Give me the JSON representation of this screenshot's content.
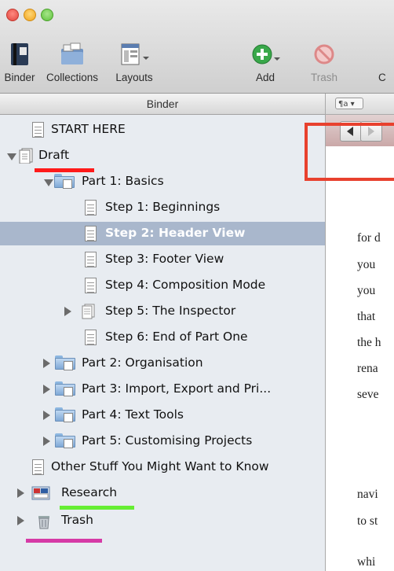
{
  "toolbar": {
    "items": [
      {
        "label": "Binder"
      },
      {
        "label": "Collections"
      },
      {
        "label": "Layouts"
      },
      {
        "label": "Add"
      },
      {
        "label": "Trash"
      },
      {
        "label": "C"
      }
    ]
  },
  "binder": {
    "title": "Binder",
    "rows": [
      {
        "label": "START HERE"
      },
      {
        "label": "Draft"
      },
      {
        "label": "Part 1: Basics"
      },
      {
        "label": "Step 1: Beginnings"
      },
      {
        "label": "Step 2: Header View"
      },
      {
        "label": "Step 3: Footer View"
      },
      {
        "label": "Step 4: Composition Mode"
      },
      {
        "label": "Step 5: The Inspector"
      },
      {
        "label": "Step 6: End of Part One"
      },
      {
        "label": "Part 2: Organisation"
      },
      {
        "label": "Part 3: Import, Export and Pri..."
      },
      {
        "label": "Part 4: Text Tools"
      },
      {
        "label": "Part 5: Customising Projects"
      },
      {
        "label": "Other Stuff You Might Want to Know"
      },
      {
        "label": "Research"
      },
      {
        "label": "Trash"
      }
    ]
  },
  "editor": {
    "format_button": "¶a ▾",
    "text_lines": [
      "for d",
      "you",
      "you",
      "that",
      "the h",
      "rena",
      "seve",
      "navi",
      "to st",
      "whi"
    ]
  },
  "colors": {
    "highlight_red": "#e8412e",
    "marker_red": "#ff1a1a",
    "marker_green": "#66ee33",
    "marker_magenta": "#d63aa6",
    "selection": "#a9b7cc"
  }
}
